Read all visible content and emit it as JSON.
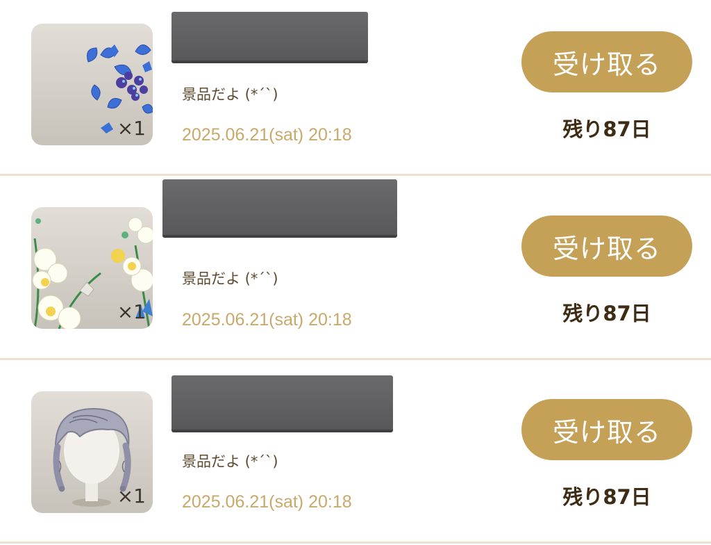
{
  "gifts": [
    {
      "item": "hydrangea",
      "quantity": "×1",
      "description": "景品だよ (*´`)",
      "date": "2025.06.21(sat) 20:18",
      "claim_label": "受け取る",
      "remaining": "残り87日"
    },
    {
      "item": "freesia",
      "quantity": "×1",
      "description": "景品だよ (*´`)",
      "date": "2025.06.21(sat) 20:18",
      "claim_label": "受け取る",
      "remaining": "残り87日"
    },
    {
      "item": "braided-hair",
      "quantity": "×1",
      "description": "景品だよ (*´`)",
      "date": "2025.06.21(sat) 20:18",
      "claim_label": "受け取る",
      "remaining": "残り87日"
    }
  ],
  "colors": {
    "button": "#c5a057",
    "date_text": "#c9a86b",
    "divider": "#ede1cf",
    "remaining_text": "#3e2c15"
  }
}
